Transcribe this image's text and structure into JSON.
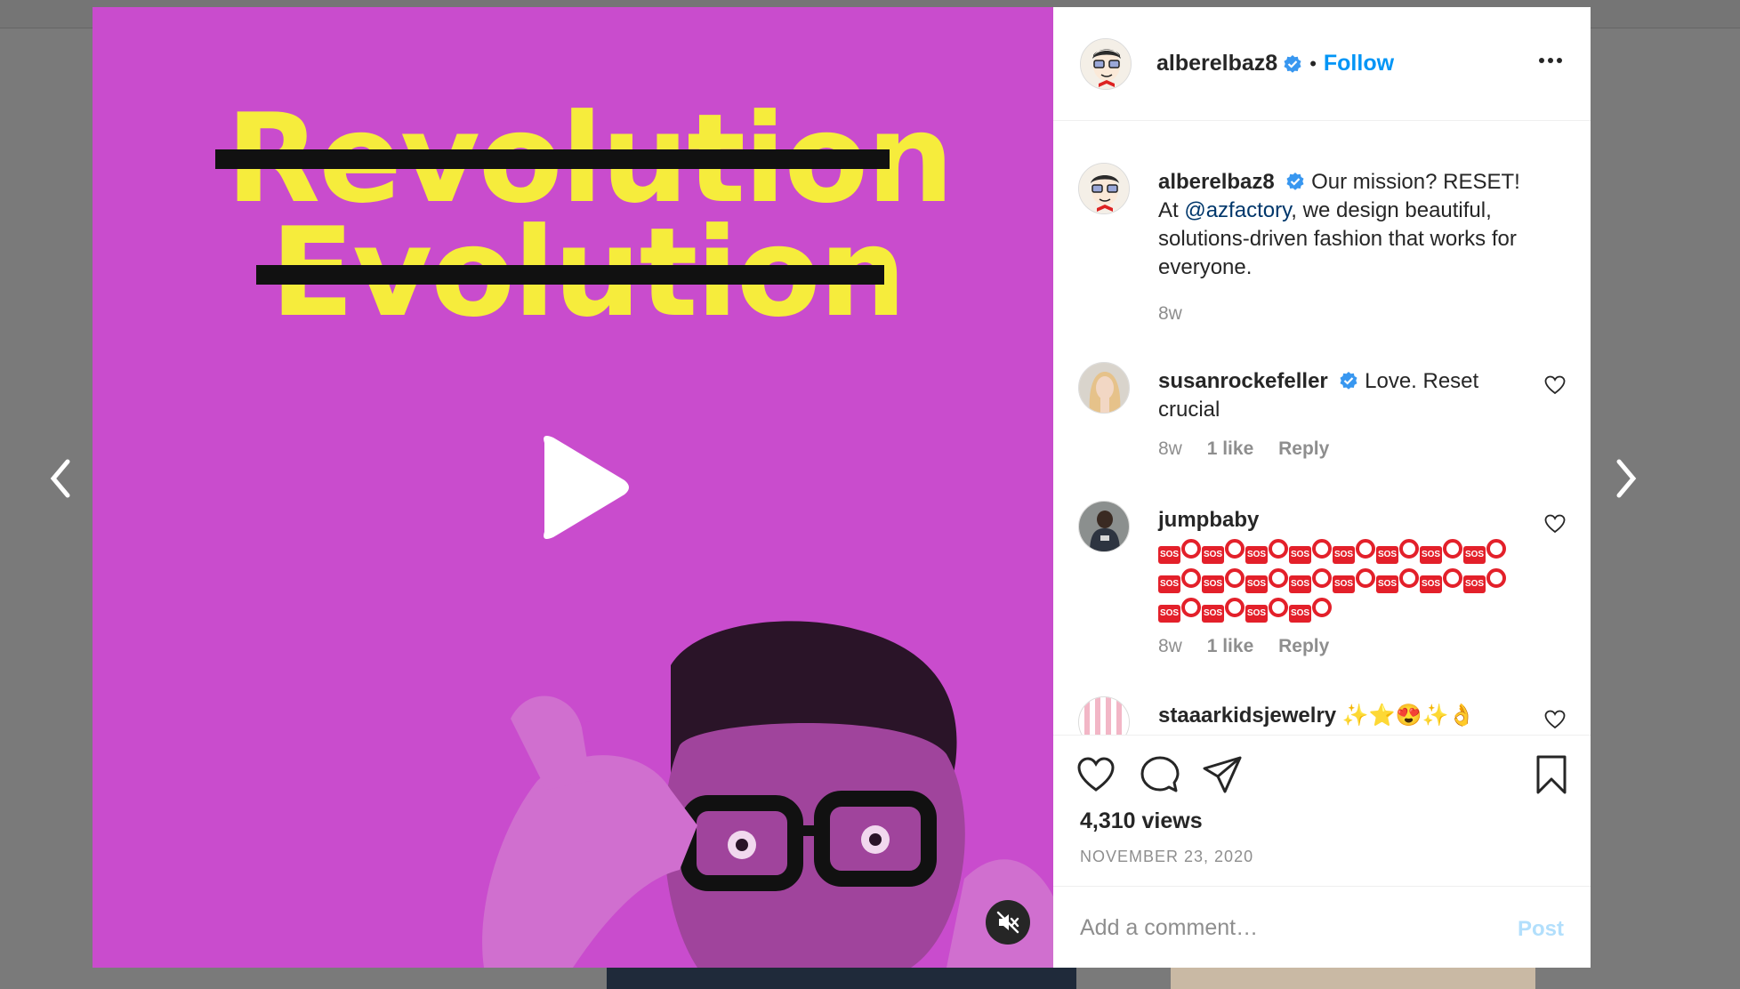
{
  "post": {
    "author": "alberelbaz8",
    "follow_label": "Follow",
    "separator": "•",
    "views": "4,310 views",
    "date": "NOVEMBER 23, 2020"
  },
  "media": {
    "line1": "Revolution",
    "line2": "Evolution",
    "background_color": "#c94ccd",
    "text_color": "#f6ec3c"
  },
  "caption": {
    "user": "alberelbaz8",
    "text_before": "Our mission? RESET! At ",
    "mention": "@azfactory",
    "text_after": ", we design beautiful, solutions-driven fashion that works for everyone.",
    "time": "8w"
  },
  "comments": [
    {
      "user": "susanrockefeller",
      "text": "Love. Reset crucial",
      "time": "8w",
      "likes": "1 like",
      "reply": "Reply"
    },
    {
      "user": "jumpbaby",
      "time": "8w",
      "likes": "1 like",
      "reply": "Reply"
    },
    {
      "user": "staaarkidsjewelry",
      "text": "✨⭐😍✨👌"
    }
  ],
  "add_comment": {
    "placeholder": "Add a comment…",
    "post_label": "Post"
  },
  "colors": {
    "accent": "#0095f6",
    "verified": "#3897f0"
  }
}
